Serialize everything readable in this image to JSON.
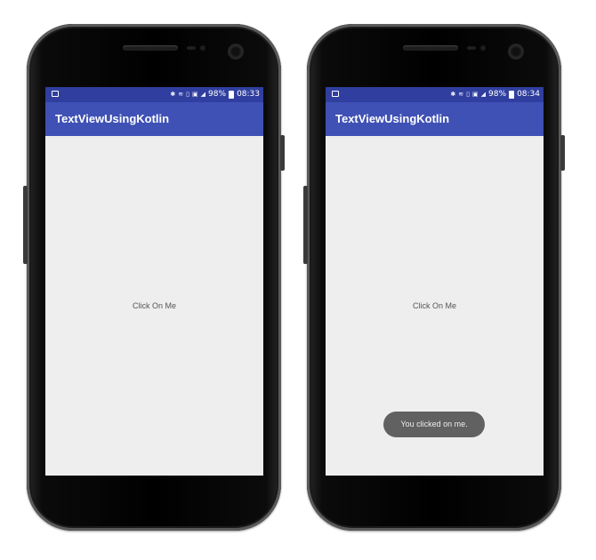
{
  "phones": [
    {
      "status": {
        "battery": "98%",
        "time": "08:33"
      },
      "app_title": "TextViewUsingKotlin",
      "center_text": "Click On Me"
    },
    {
      "status": {
        "battery": "98%",
        "time": "08:34"
      },
      "app_title": "TextViewUsingKotlin",
      "center_text": "Click On Me",
      "toast": "You clicked on me."
    }
  ],
  "colors": {
    "status_bar": "#303f9f",
    "app_bar": "#3f51b5",
    "background": "#eeeeee",
    "toast": "#616161"
  },
  "icons": [
    "notification-icon",
    "bluetooth-icon",
    "vibrate-icon",
    "volte-icon",
    "lte-icon",
    "signal-icon",
    "battery-icon"
  ]
}
